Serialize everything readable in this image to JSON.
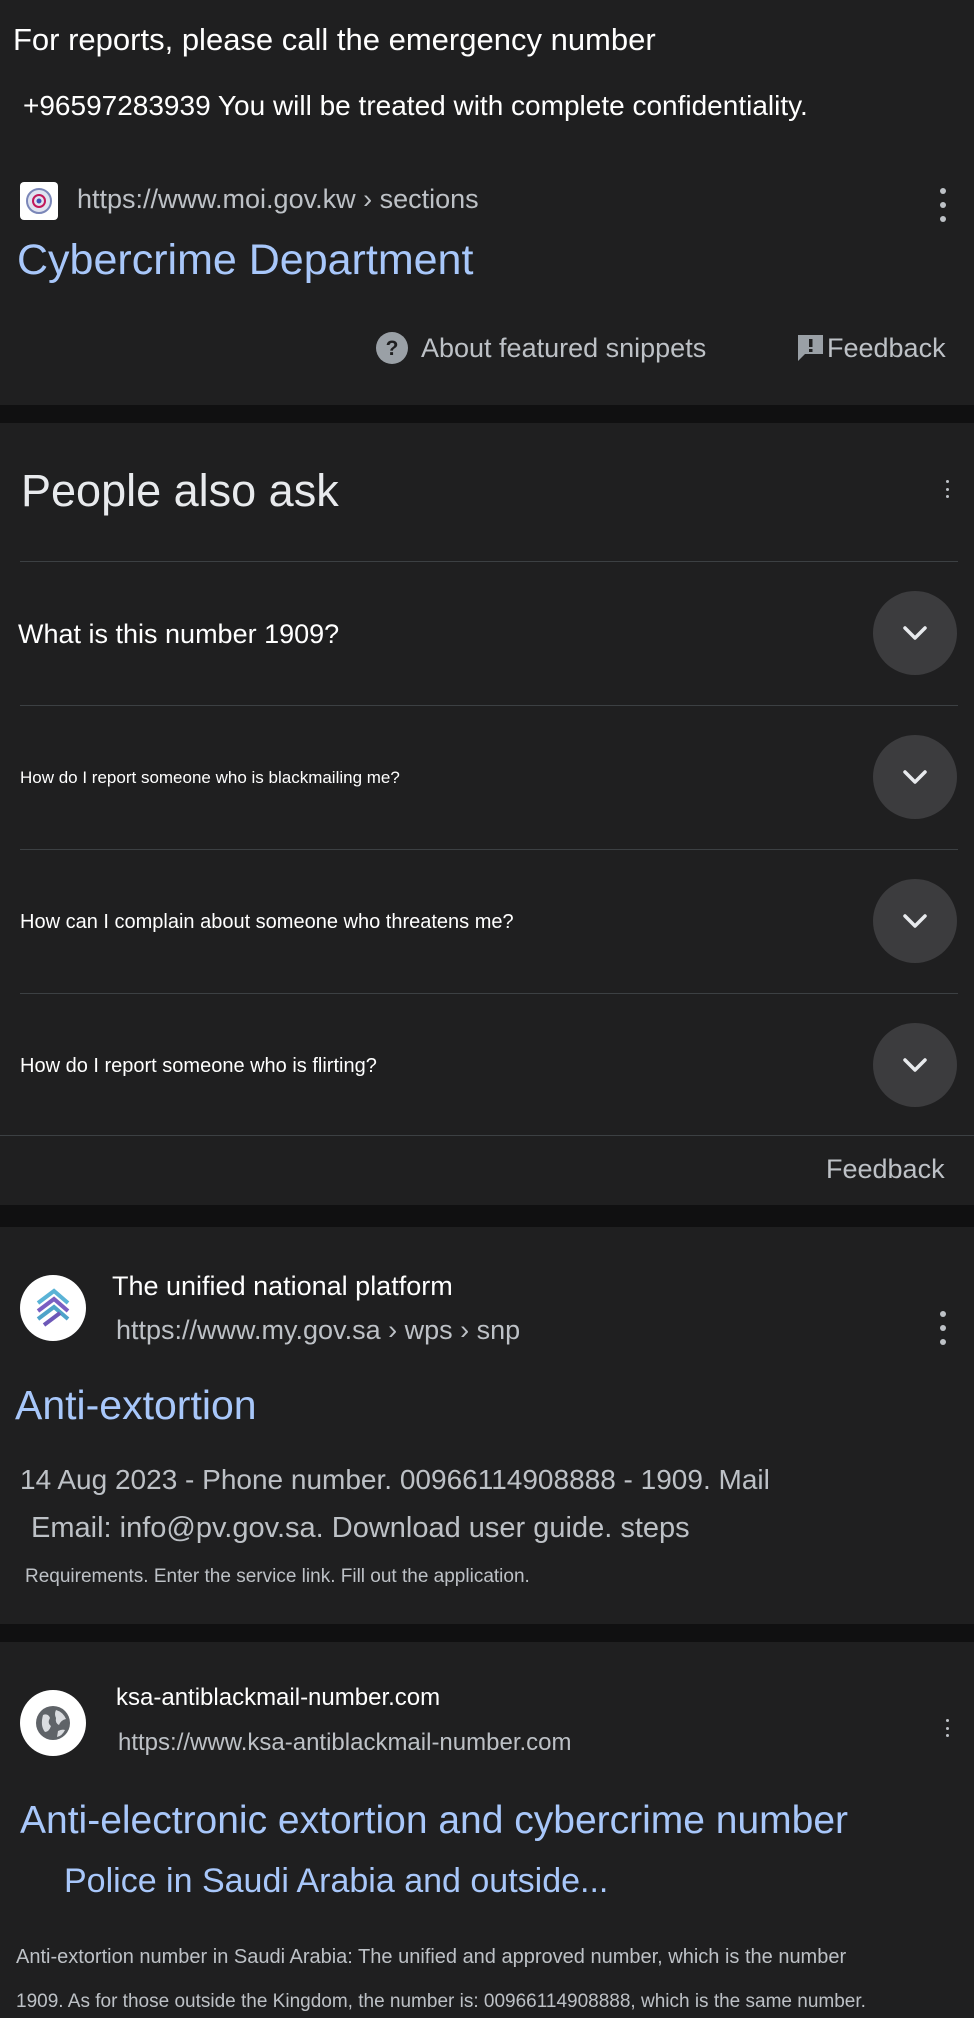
{
  "snippet": {
    "line1": "For reports, please call the emergency number",
    "line2": "+96597283939 You will be treated with complete confidentiality.",
    "url": "https://www.moi.gov.kw › sections",
    "title": "Cybercrime Department",
    "about_label": "About featured snippets",
    "feedback_label": "Feedback"
  },
  "paa": {
    "heading": "People also ask",
    "questions": [
      "What is this number 1909?",
      "How do I report someone who is blackmailing me?",
      "How can I complain about someone who threatens me?",
      "How do I report someone who is flirting?"
    ],
    "feedback_label": "Feedback"
  },
  "result1": {
    "site_name": "The unified national platform",
    "url": "https://www.my.gov.sa › wps › snp",
    "title": "Anti-extortion",
    "desc_line1": "14 Aug 2023 - Phone number. 00966114908888 - 1909. Mail",
    "desc_line2": "Email: info@pv.gov.sa. Download user guide. steps",
    "desc_line3": "Requirements. Enter the service link. Fill out the application."
  },
  "result2": {
    "site_name": "ksa-antiblackmail-number.com",
    "url": "https://www.ksa-antiblackmail-number.com",
    "title_line1": "Anti-electronic extortion and cybercrime number",
    "title_line2": "Police in Saudi Arabia and outside...",
    "desc_line1": "Anti-extortion number in Saudi Arabia: The unified and approved number, which is the number",
    "desc_line2": "1909. As for those outside the Kingdom, the number is: 00966114908888, which is the same number."
  },
  "colors": {
    "background": "#1f1f20",
    "link": "#a8c7fa",
    "text": "#e8eaed",
    "muted": "#bdc1c6"
  },
  "icons": [
    "moi-favicon",
    "kebab-menu-icon",
    "help-circle-icon",
    "feedback-icon",
    "chevron-down-icon",
    "unified-platform-logo",
    "globe-icon"
  ]
}
